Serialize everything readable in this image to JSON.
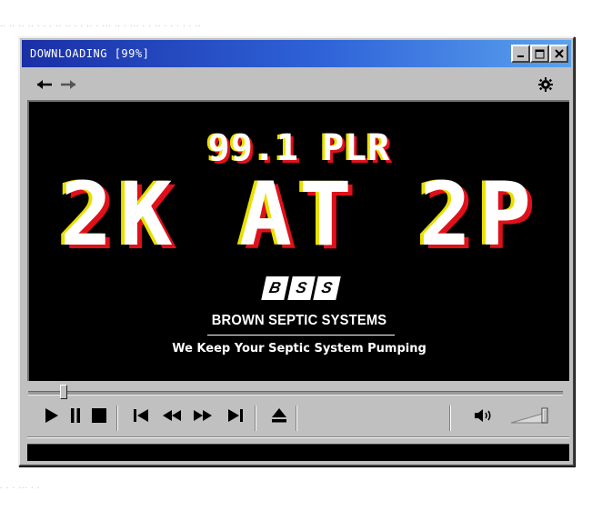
{
  "window": {
    "title": "DOWNLOADING [99%]",
    "progress_percent": 99
  },
  "titlebar": {
    "minimize_icon": "minimize-icon",
    "maximize_icon": "maximize-icon",
    "close_icon": "close-icon"
  },
  "nav": {
    "back_icon": "arrow-left-icon",
    "forward_icon": "arrow-right-icon",
    "settings_icon": "gear-icon"
  },
  "video": {
    "station": "99.1 PLR",
    "slot": "2K AT 2P",
    "logo_letters": [
      "B",
      "S",
      "S"
    ],
    "company": "BROWN SEPTIC SYSTEMS",
    "tagline": "We Keep Your Septic System Pumping"
  },
  "playback": {
    "position_fraction": 0.06,
    "volume_fraction": 1.0
  },
  "controls": {
    "play_icon": "play-icon",
    "pause_icon": "pause-icon",
    "stop_icon": "stop-icon",
    "previous_icon": "skip-previous-icon",
    "rewind_icon": "rewind-icon",
    "fast_forward_icon": "fast-forward-icon",
    "next_icon": "skip-next-icon",
    "eject_icon": "eject-icon",
    "volume_icon": "speaker-icon"
  },
  "status": {
    "text": ""
  },
  "colors": {
    "titlebar_start": "#1a2fa6",
    "titlebar_end": "#5aa2ee",
    "chrome": "#c0c0c0",
    "screen": "#000000",
    "glitch_yellow": "#e8e000",
    "glitch_red": "#e0101a"
  }
}
